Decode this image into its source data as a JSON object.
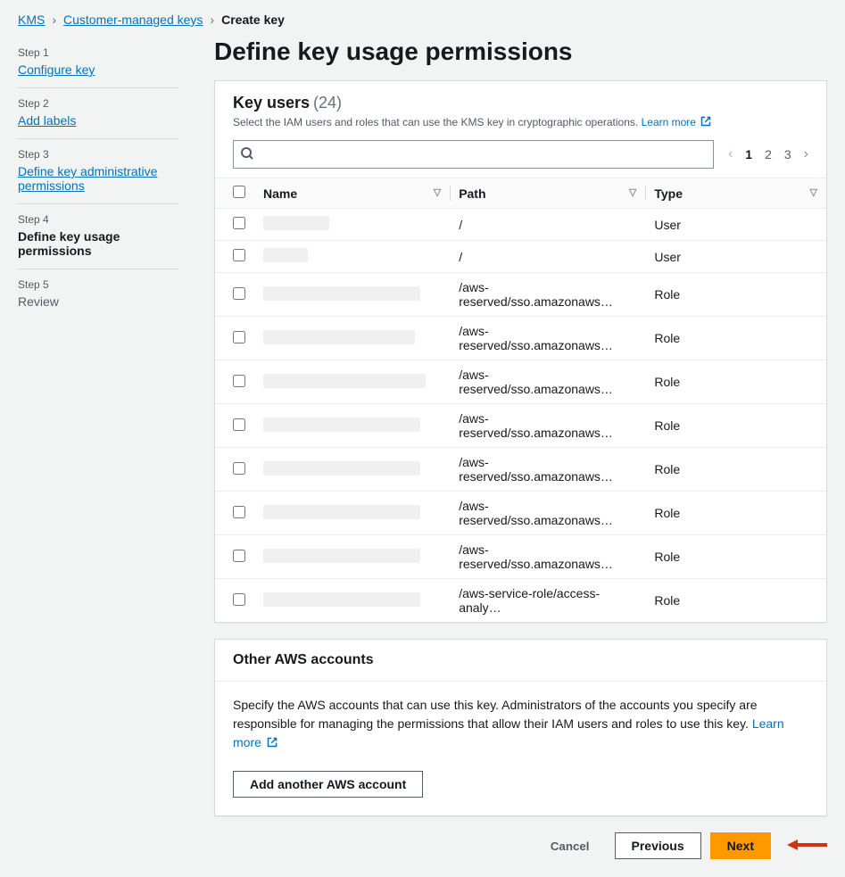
{
  "breadcrumb": {
    "root": "KMS",
    "section": "Customer-managed keys",
    "current": "Create key"
  },
  "sidebar": {
    "steps": [
      {
        "label": "Step 1",
        "title": "Configure key",
        "state": "link"
      },
      {
        "label": "Step 2",
        "title": "Add labels",
        "state": "link"
      },
      {
        "label": "Step 3",
        "title": "Define key administrative permissions",
        "state": "link"
      },
      {
        "label": "Step 4",
        "title": "Define key usage permissions",
        "state": "active"
      },
      {
        "label": "Step 5",
        "title": "Review",
        "state": "future"
      }
    ]
  },
  "page": {
    "title": "Define key usage permissions"
  },
  "keyusers": {
    "title": "Key users",
    "count": "(24)",
    "desc": "Select the IAM users and roles that can use the KMS key in cryptographic operations.",
    "learn_more": "Learn more",
    "search_placeholder": "",
    "pagination": {
      "pages": [
        "1",
        "2",
        "3"
      ],
      "active": 0
    },
    "columns": {
      "name": "Name",
      "path": "Path",
      "type": "Type"
    },
    "rows": [
      {
        "name": "",
        "redact_w": 74,
        "path": "/",
        "type": "User"
      },
      {
        "name": "",
        "redact_w": 50,
        "path": "/",
        "type": "User"
      },
      {
        "name": "",
        "redact_w": 176,
        "path": "/aws-reserved/sso.amazonaws…",
        "type": "Role"
      },
      {
        "name": "",
        "redact_w": 170,
        "path": "/aws-reserved/sso.amazonaws…",
        "type": "Role"
      },
      {
        "name": "",
        "redact_w": 182,
        "path": "/aws-reserved/sso.amazonaws…",
        "type": "Role"
      },
      {
        "name": "",
        "redact_w": 176,
        "path": "/aws-reserved/sso.amazonaws…",
        "type": "Role"
      },
      {
        "name": "",
        "redact_w": 176,
        "path": "/aws-reserved/sso.amazonaws…",
        "type": "Role"
      },
      {
        "name": "",
        "redact_w": 176,
        "path": "/aws-reserved/sso.amazonaws…",
        "type": "Role"
      },
      {
        "name": "",
        "redact_w": 176,
        "path": "/aws-reserved/sso.amazonaws…",
        "type": "Role"
      },
      {
        "name": "",
        "redact_w": 176,
        "path": "/aws-service-role/access-analy…",
        "type": "Role"
      }
    ]
  },
  "otheraccounts": {
    "title": "Other AWS accounts",
    "desc": "Specify the AWS accounts that can use this key. Administrators of the accounts you specify are responsible for managing the permissions that allow their IAM users and roles to use this key.",
    "learn_more": "Learn more",
    "add_button": "Add another AWS account"
  },
  "footer": {
    "cancel": "Cancel",
    "previous": "Previous",
    "next": "Next"
  }
}
